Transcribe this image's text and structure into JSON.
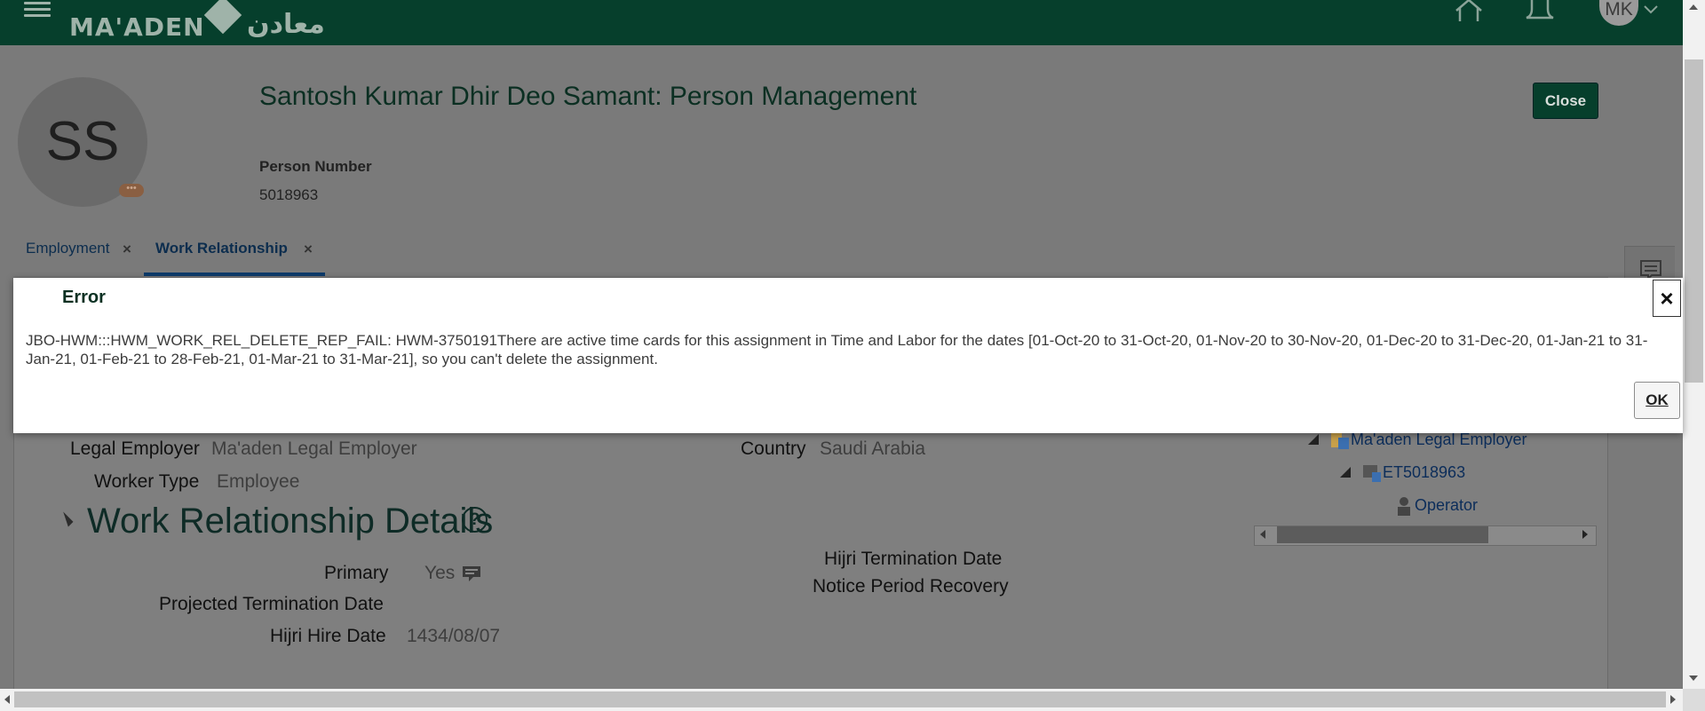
{
  "header": {
    "logo_latin": "MA'ADEN",
    "logo_arabic": "معادن",
    "user_initials": "MK"
  },
  "person": {
    "initials": "SS",
    "title": "Santosh Kumar Dhir Deo Samant: Person Management",
    "number_label": "Person Number",
    "number_value": "5018963",
    "status_icon": "•••"
  },
  "close_button": "Close",
  "tabs": [
    {
      "label": "Employment",
      "close": "×",
      "active": false
    },
    {
      "label": "Work Relationship",
      "close": "×",
      "active": true
    }
  ],
  "summary": {
    "legal_employer_label": "Legal Employer",
    "legal_employer_value": "Ma'aden Legal Employer",
    "worker_type_label": "Worker Type",
    "worker_type_value": "Employee",
    "country_label": "Country",
    "country_value": "Saudi Arabia"
  },
  "section": {
    "title": "Work Relationship Details",
    "help": "?",
    "primary_label": "Primary",
    "primary_value": "Yes",
    "projected_termination_label": "Projected Termination Date",
    "hijri_hire_label": "Hijri Hire Date",
    "hijri_hire_value": "1434/08/07",
    "hijri_termination_label": "Hijri Termination Date",
    "notice_period_label": "Notice Period Recovery"
  },
  "tree": {
    "employer": "Ma'aden Legal Employer",
    "assignment": "ET5018963",
    "job": "Operator"
  },
  "dialog": {
    "title": "Error",
    "close": "×",
    "message": "JBO-HWM:::HWM_WORK_REL_DELETE_REP_FAIL: HWM-3750191There are active time cards for this assignment in Time and Labor for the dates [01-Oct-20 to 31-Oct-20, 01-Nov-20 to 30-Nov-20, 01-Dec-20 to 31-Dec-20, 01-Jan-21 to 31-Jan-21, 01-Feb-21 to 28-Feb-21, 01-Mar-21 to 31-Mar-21], so you can't delete the assignment.",
    "ok": "OK"
  },
  "icons": [
    "hamburger-icon",
    "home-icon",
    "bell-icon",
    "chevron-down-icon",
    "help-icon",
    "close-icon",
    "org-icon",
    "assignment-icon",
    "person-icon",
    "view-icon",
    "panel-icon"
  ]
}
